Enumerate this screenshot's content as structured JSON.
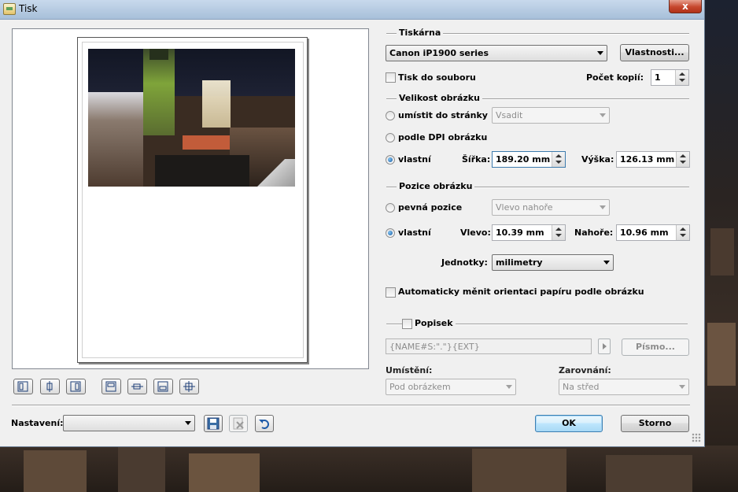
{
  "window": {
    "title": "Tisk",
    "close_glyph": "x"
  },
  "printer": {
    "group_label": "Tiskárna",
    "selected": "Canon iP1900 series",
    "properties_button": "Vlastnosti...",
    "print_to_file_label": "Tisk do souboru",
    "print_to_file_checked": false,
    "copies_label": "Počet kopií:",
    "copies_value": "1"
  },
  "image_size": {
    "group_label": "Velikost obrázku",
    "fit_page_label": "umístit do stránky",
    "fit_page_option": "Vsadit",
    "dpi_label": "podle DPI obrázku",
    "custom_label": "vlastní",
    "width_label": "Šířka:",
    "width_value": "189.20 mm",
    "height_label": "Výška:",
    "height_value": "126.13 mm",
    "selected": "custom"
  },
  "image_position": {
    "group_label": "Pozice obrázku",
    "fixed_label": "pevná pozice",
    "fixed_option": "Vlevo nahoře",
    "custom_label": "vlastní",
    "left_label": "Vlevo:",
    "left_value": "10.39 mm",
    "top_label": "Nahoře:",
    "top_value": "10.96 mm",
    "selected": "custom"
  },
  "units": {
    "label": "Jednotky:",
    "selected": "milimetry"
  },
  "auto_orientation": {
    "label": "Automaticky měnit orientaci papíru podle obrázku",
    "checked": false
  },
  "caption": {
    "group_label": "Popisek",
    "checked": false,
    "template": "{NAME#S:\".\"}{EXT}",
    "font_button": "Písmo...",
    "placement_label": "Umístění:",
    "placement_value": "Pod obrázkem",
    "alignment_label": "Zarovnání:",
    "alignment_value": "Na střed"
  },
  "alignment_toolbar": {
    "icons": [
      "align-left-icon",
      "align-center-horizontal-icon",
      "align-right-icon",
      "align-top-icon",
      "align-center-vertical-icon",
      "align-bottom-icon",
      "align-center-both-icon"
    ]
  },
  "settings": {
    "label": "Nastavení:",
    "selected": ""
  },
  "settings_icons": [
    "save-icon",
    "delete-icon",
    "undo-icon"
  ],
  "actions": {
    "ok": "OK",
    "cancel": "Storno"
  },
  "colors": {
    "accent": "#3c7fb1",
    "title_bar": "#b7cde6",
    "dialog_bg": "#f0f0f0"
  }
}
